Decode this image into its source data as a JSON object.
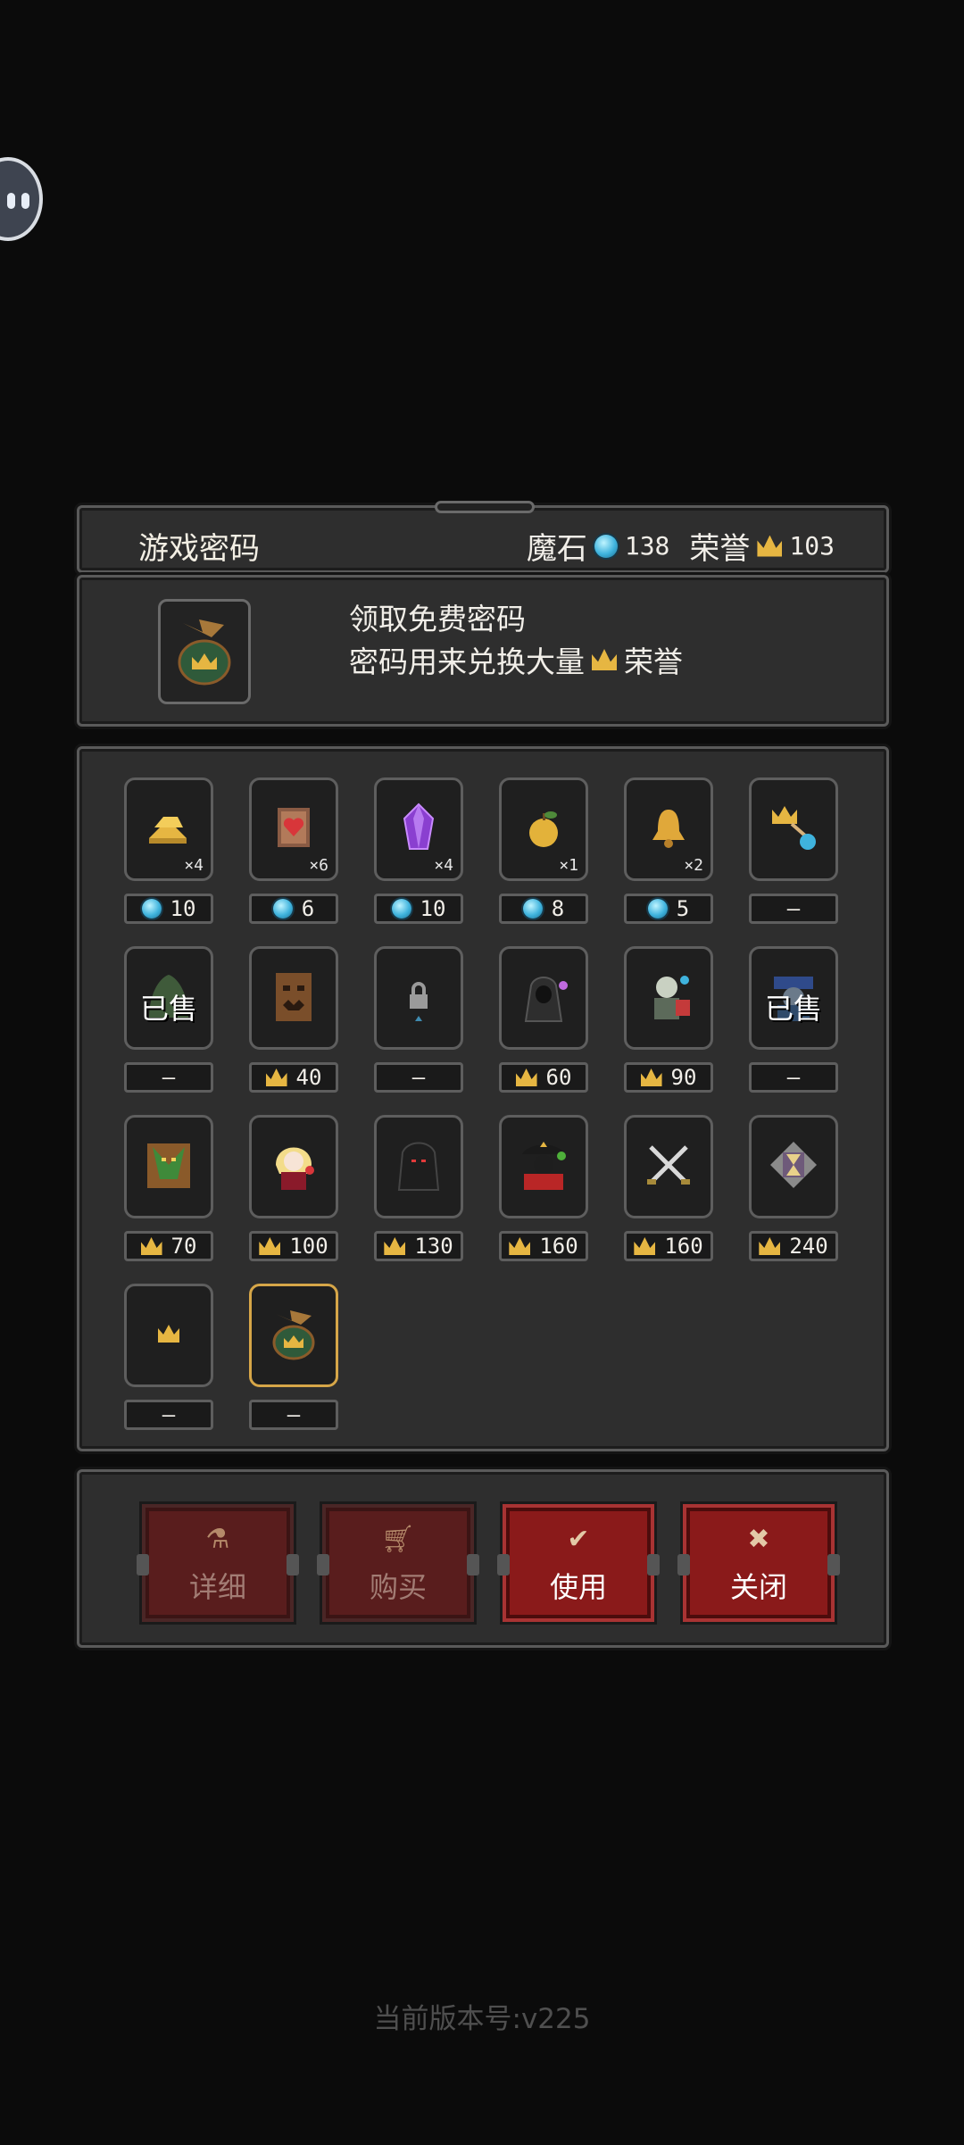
{
  "header": {
    "title": "游戏密码",
    "magic_stone_label": "魔石",
    "magic_stone_value": "138",
    "honor_label": "荣誉",
    "honor_value": "103"
  },
  "info": {
    "line1": "领取免费密码",
    "line2_prefix": "密码用来兑换大量",
    "line2_suffix": "荣誉"
  },
  "items": [
    {
      "icon": "gold-bars-icon",
      "qty": "×4",
      "price": "10",
      "currency": "gem"
    },
    {
      "icon": "heart-scroll-icon",
      "qty": "×6",
      "price": "6",
      "currency": "gem"
    },
    {
      "icon": "purple-crystal-icon",
      "qty": "×4",
      "price": "10",
      "currency": "gem"
    },
    {
      "icon": "golden-apple-icon",
      "qty": "×1",
      "price": "8",
      "currency": "gem"
    },
    {
      "icon": "golden-bell-icon",
      "qty": "×2",
      "price": "5",
      "currency": "gem"
    },
    {
      "icon": "crown-to-gem-icon",
      "price": "—",
      "currency": "none"
    },
    {
      "icon": "green-slime-icon",
      "sold": "已售",
      "price": "—",
      "currency": "none"
    },
    {
      "icon": "treant-icon",
      "price": "40",
      "currency": "crown"
    },
    {
      "icon": "lock-icon",
      "price": "—",
      "currency": "none"
    },
    {
      "icon": "hooded-mage-icon",
      "price": "60",
      "currency": "crown"
    },
    {
      "icon": "knight-icon",
      "price": "90",
      "currency": "crown"
    },
    {
      "icon": "blue-hat-mage-icon",
      "sold": "已售",
      "price": "—",
      "currency": "none"
    },
    {
      "icon": "leaf-warrior-icon",
      "price": "70",
      "currency": "crown"
    },
    {
      "icon": "blonde-girl-icon",
      "price": "100",
      "currency": "crown"
    },
    {
      "icon": "dark-hood-icon",
      "price": "130",
      "currency": "crown"
    },
    {
      "icon": "pirate-captain-icon",
      "price": "160",
      "currency": "crown"
    },
    {
      "icon": "crossed-swords-icon",
      "price": "160",
      "currency": "crown"
    },
    {
      "icon": "hourglass-icon",
      "price": "240",
      "currency": "crown"
    },
    {
      "icon": "crown-icon",
      "price": "—",
      "currency": "none"
    },
    {
      "icon": "crown-bag-icon",
      "price": "—",
      "currency": "none",
      "selected": true
    }
  ],
  "buttons": {
    "detail": "详细",
    "buy": "购买",
    "use": "使用",
    "close": "关闭"
  },
  "version": "当前版本号:v225",
  "colors": {
    "accent_gold": "#e6b642",
    "gem_blue": "#3fb3dd",
    "button_red": "#8a1a1a"
  }
}
